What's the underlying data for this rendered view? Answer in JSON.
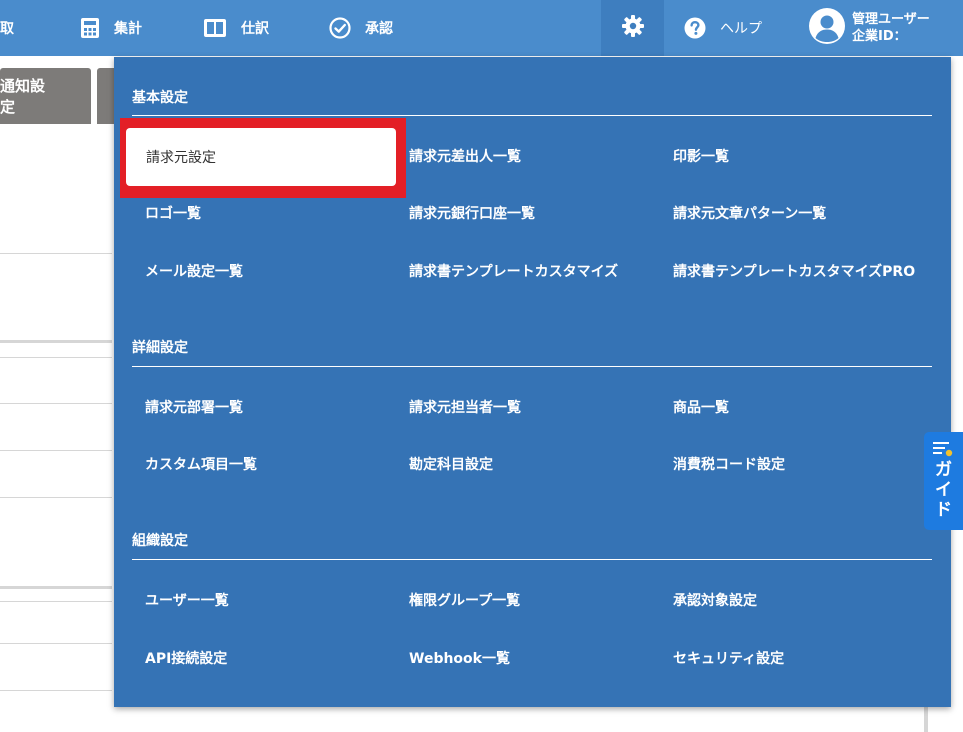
{
  "nav": {
    "partial_label": "取",
    "items": [
      {
        "label": "集計",
        "icon": "calculator-icon"
      },
      {
        "label": "仕訳",
        "icon": "book-icon"
      },
      {
        "label": "承認",
        "icon": "check-circle-icon"
      }
    ],
    "help_label": "ヘルプ",
    "user": {
      "name": "管理ユーザー",
      "company_id": "企業ID："
    }
  },
  "tabs": {
    "visible_tab": "通知設定"
  },
  "menu": {
    "sections": [
      {
        "title": "基本設定",
        "items": [
          "請求元設定",
          "請求元差出人一覧",
          "印影一覧",
          "ロゴ一覧",
          "請求元銀行口座一覧",
          "請求元文章パターン一覧",
          "メール設定一覧",
          "請求書テンプレートカスタマイズ",
          "請求書テンプレートカスタマイズPRO"
        ]
      },
      {
        "title": "詳細設定",
        "items": [
          "請求元部署一覧",
          "請求元担当者一覧",
          "商品一覧",
          "カスタム項目一覧",
          "勘定科目設定",
          "消費税コード設定"
        ]
      },
      {
        "title": "組織設定",
        "items": [
          "ユーザー一覧",
          "権限グループ一覧",
          "承認対象設定",
          "API接続設定",
          "Webhook一覧",
          "セキュリティ設定"
        ]
      }
    ]
  },
  "guide": {
    "label": "ガイド"
  },
  "colors": {
    "header": "#4a8ccc",
    "menu_bg": "#3573b5",
    "highlight": "#e31f26",
    "guide": "#1e7be0"
  }
}
